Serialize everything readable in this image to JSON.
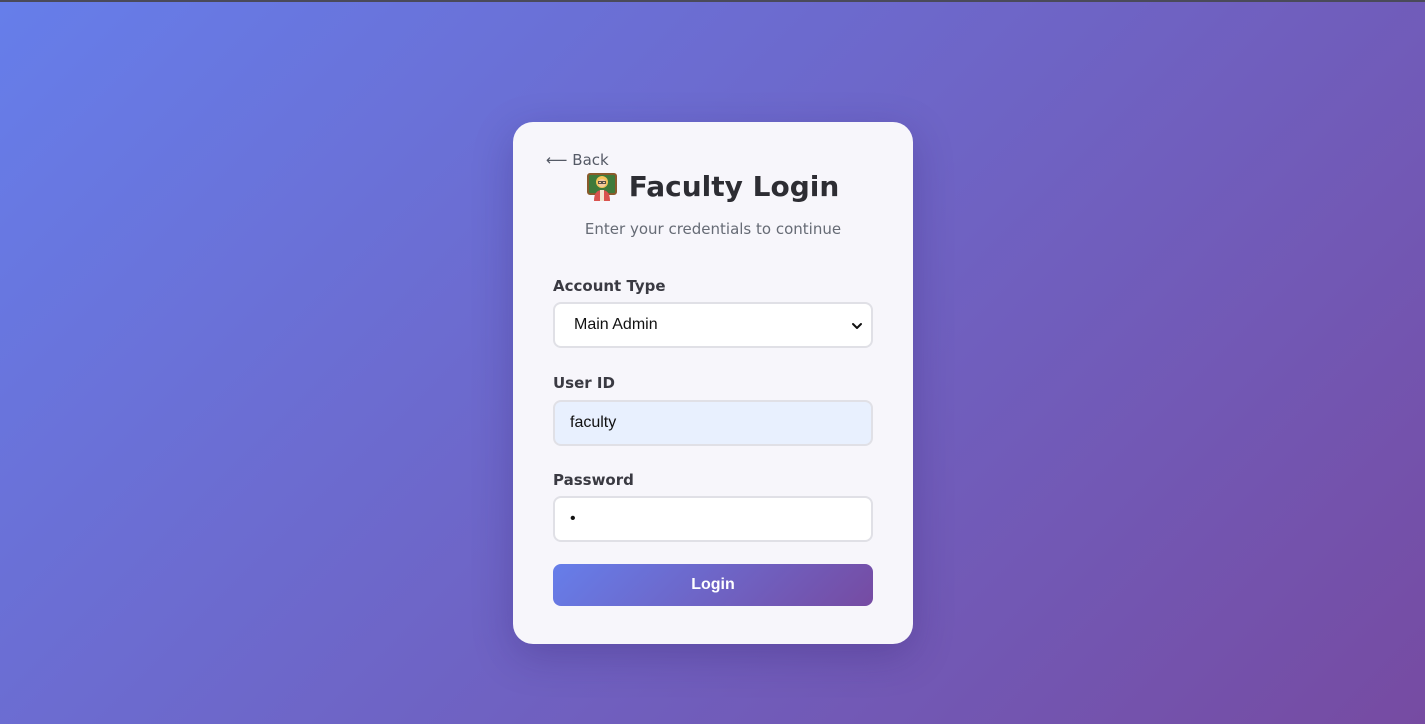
{
  "back_label": "⟵ Back",
  "title": "Faculty Login",
  "title_icon": "teacher-icon",
  "subtitle": "Enter your credentials to continue",
  "account_type": {
    "label": "Account Type",
    "selected": "Main Admin"
  },
  "user_id": {
    "label": "User ID",
    "value": "faculty"
  },
  "password": {
    "label": "Password",
    "masked_value": "•"
  },
  "login_label": "Login",
  "colors": {
    "gradient_start": "#667eea",
    "gradient_end": "#764ba2",
    "card_bg": "#f7f6fb",
    "autofill_bg": "#e8f0fe"
  }
}
